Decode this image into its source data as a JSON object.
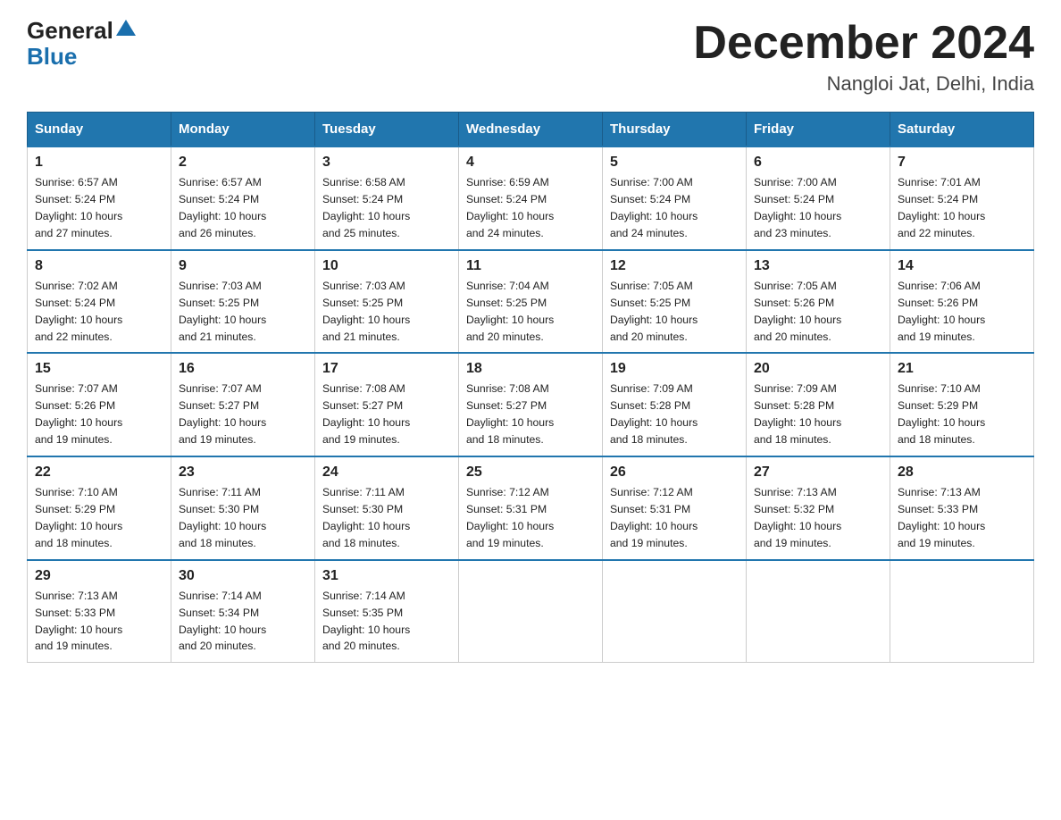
{
  "header": {
    "logo_general": "General",
    "logo_blue": "Blue",
    "month_title": "December 2024",
    "location": "Nangloi Jat, Delhi, India"
  },
  "days_of_week": [
    "Sunday",
    "Monday",
    "Tuesday",
    "Wednesday",
    "Thursday",
    "Friday",
    "Saturday"
  ],
  "weeks": [
    [
      {
        "day": "1",
        "sunrise": "6:57 AM",
        "sunset": "5:24 PM",
        "daylight": "10 hours and 27 minutes."
      },
      {
        "day": "2",
        "sunrise": "6:57 AM",
        "sunset": "5:24 PM",
        "daylight": "10 hours and 26 minutes."
      },
      {
        "day": "3",
        "sunrise": "6:58 AM",
        "sunset": "5:24 PM",
        "daylight": "10 hours and 25 minutes."
      },
      {
        "day": "4",
        "sunrise": "6:59 AM",
        "sunset": "5:24 PM",
        "daylight": "10 hours and 24 minutes."
      },
      {
        "day": "5",
        "sunrise": "7:00 AM",
        "sunset": "5:24 PM",
        "daylight": "10 hours and 24 minutes."
      },
      {
        "day": "6",
        "sunrise": "7:00 AM",
        "sunset": "5:24 PM",
        "daylight": "10 hours and 23 minutes."
      },
      {
        "day": "7",
        "sunrise": "7:01 AM",
        "sunset": "5:24 PM",
        "daylight": "10 hours and 22 minutes."
      }
    ],
    [
      {
        "day": "8",
        "sunrise": "7:02 AM",
        "sunset": "5:24 PM",
        "daylight": "10 hours and 22 minutes."
      },
      {
        "day": "9",
        "sunrise": "7:03 AM",
        "sunset": "5:25 PM",
        "daylight": "10 hours and 21 minutes."
      },
      {
        "day": "10",
        "sunrise": "7:03 AM",
        "sunset": "5:25 PM",
        "daylight": "10 hours and 21 minutes."
      },
      {
        "day": "11",
        "sunrise": "7:04 AM",
        "sunset": "5:25 PM",
        "daylight": "10 hours and 20 minutes."
      },
      {
        "day": "12",
        "sunrise": "7:05 AM",
        "sunset": "5:25 PM",
        "daylight": "10 hours and 20 minutes."
      },
      {
        "day": "13",
        "sunrise": "7:05 AM",
        "sunset": "5:26 PM",
        "daylight": "10 hours and 20 minutes."
      },
      {
        "day": "14",
        "sunrise": "7:06 AM",
        "sunset": "5:26 PM",
        "daylight": "10 hours and 19 minutes."
      }
    ],
    [
      {
        "day": "15",
        "sunrise": "7:07 AM",
        "sunset": "5:26 PM",
        "daylight": "10 hours and 19 minutes."
      },
      {
        "day": "16",
        "sunrise": "7:07 AM",
        "sunset": "5:27 PM",
        "daylight": "10 hours and 19 minutes."
      },
      {
        "day": "17",
        "sunrise": "7:08 AM",
        "sunset": "5:27 PM",
        "daylight": "10 hours and 19 minutes."
      },
      {
        "day": "18",
        "sunrise": "7:08 AM",
        "sunset": "5:27 PM",
        "daylight": "10 hours and 18 minutes."
      },
      {
        "day": "19",
        "sunrise": "7:09 AM",
        "sunset": "5:28 PM",
        "daylight": "10 hours and 18 minutes."
      },
      {
        "day": "20",
        "sunrise": "7:09 AM",
        "sunset": "5:28 PM",
        "daylight": "10 hours and 18 minutes."
      },
      {
        "day": "21",
        "sunrise": "7:10 AM",
        "sunset": "5:29 PM",
        "daylight": "10 hours and 18 minutes."
      }
    ],
    [
      {
        "day": "22",
        "sunrise": "7:10 AM",
        "sunset": "5:29 PM",
        "daylight": "10 hours and 18 minutes."
      },
      {
        "day": "23",
        "sunrise": "7:11 AM",
        "sunset": "5:30 PM",
        "daylight": "10 hours and 18 minutes."
      },
      {
        "day": "24",
        "sunrise": "7:11 AM",
        "sunset": "5:30 PM",
        "daylight": "10 hours and 18 minutes."
      },
      {
        "day": "25",
        "sunrise": "7:12 AM",
        "sunset": "5:31 PM",
        "daylight": "10 hours and 19 minutes."
      },
      {
        "day": "26",
        "sunrise": "7:12 AM",
        "sunset": "5:31 PM",
        "daylight": "10 hours and 19 minutes."
      },
      {
        "day": "27",
        "sunrise": "7:13 AM",
        "sunset": "5:32 PM",
        "daylight": "10 hours and 19 minutes."
      },
      {
        "day": "28",
        "sunrise": "7:13 AM",
        "sunset": "5:33 PM",
        "daylight": "10 hours and 19 minutes."
      }
    ],
    [
      {
        "day": "29",
        "sunrise": "7:13 AM",
        "sunset": "5:33 PM",
        "daylight": "10 hours and 19 minutes."
      },
      {
        "day": "30",
        "sunrise": "7:14 AM",
        "sunset": "5:34 PM",
        "daylight": "10 hours and 20 minutes."
      },
      {
        "day": "31",
        "sunrise": "7:14 AM",
        "sunset": "5:35 PM",
        "daylight": "10 hours and 20 minutes."
      },
      null,
      null,
      null,
      null
    ]
  ],
  "labels": {
    "sunrise": "Sunrise:",
    "sunset": "Sunset:",
    "daylight": "Daylight:"
  }
}
